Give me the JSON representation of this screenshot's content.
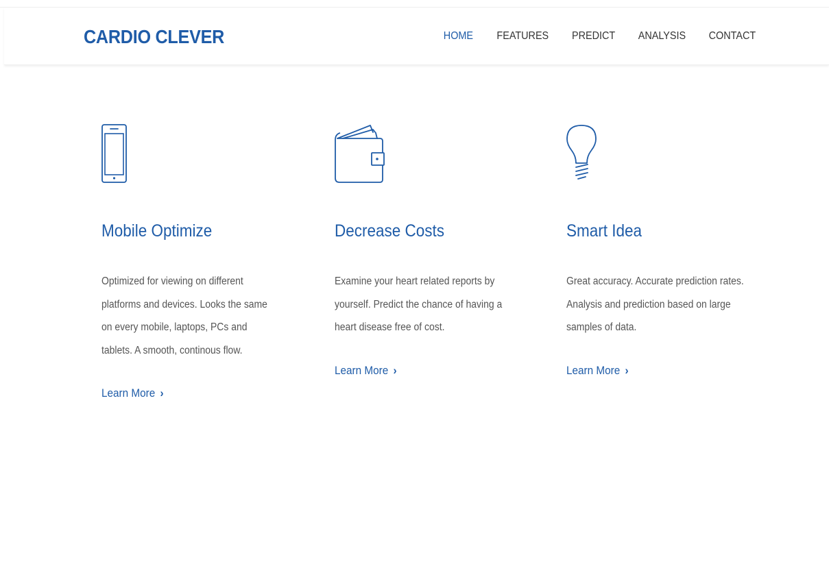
{
  "brand": {
    "name": "CARDIO CLEVER"
  },
  "nav": {
    "items": [
      {
        "label": "HOME",
        "active": true
      },
      {
        "label": "FEATURES",
        "active": false
      },
      {
        "label": "PREDICT",
        "active": false
      },
      {
        "label": "ANALYSIS",
        "active": false
      },
      {
        "label": "CONTACT",
        "active": false
      }
    ]
  },
  "features": [
    {
      "icon": "mobile-phone-icon",
      "title": "Mobile Optimize",
      "description": "Optimized for viewing on different platforms and devices. Looks the same on every mobile, laptops, PCs and tablets. A smooth, continous flow.",
      "link": "Learn More"
    },
    {
      "icon": "wallet-icon",
      "title": "Decrease Costs",
      "description": "Examine your heart related reports by yourself. Predict the chance of having a heart disease free of cost.",
      "link": "Learn More"
    },
    {
      "icon": "lightbulb-icon",
      "title": "Smart Idea",
      "description": "Great accuracy. Accurate prediction rates. Analysis and prediction based on large samples of data.",
      "link": "Learn More"
    }
  ],
  "colors": {
    "brand": "#1f5ca8",
    "nav_text": "#333333",
    "body_text": "#555555"
  }
}
